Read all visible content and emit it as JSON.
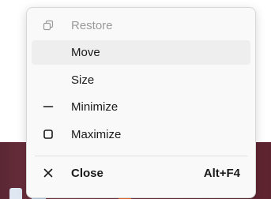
{
  "menu": {
    "items": [
      {
        "label": "Restore",
        "icon": "restore-icon",
        "disabled": true
      },
      {
        "label": "Move",
        "highlighted": true
      },
      {
        "label": "Size"
      },
      {
        "label": "Minimize",
        "icon": "minimize-icon"
      },
      {
        "label": "Maximize",
        "icon": "maximize-icon"
      },
      {
        "label": "Close",
        "icon": "close-icon",
        "shortcut": "Alt+F4"
      }
    ]
  },
  "colors": {
    "menu_background": "#f9f9f9",
    "highlight": "#eeeeee",
    "disabled_text": "#9a9a9a",
    "text": "#1a1a1a",
    "taskbar": "#6c2d3a"
  }
}
